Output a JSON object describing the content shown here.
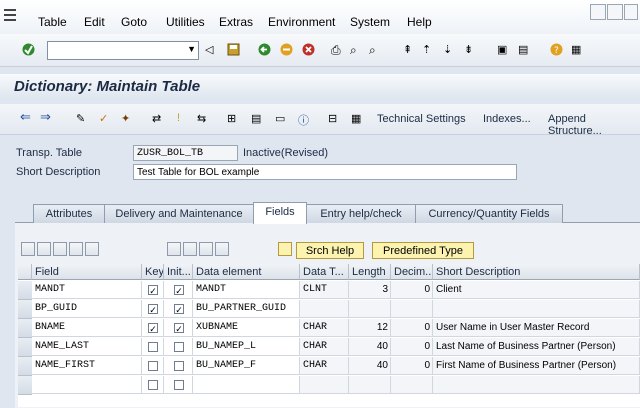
{
  "menu": [
    "Table",
    "Edit",
    "Goto",
    "Utilities",
    "Extras",
    "Environment",
    "System",
    "Help"
  ],
  "title": "Dictionary: Maintain Table",
  "app_toolbar": {
    "technical_settings": "Technical Settings",
    "indexes": "Indexes...",
    "append_structure": "Append Structure..."
  },
  "header": {
    "transp_table_label": "Transp. Table",
    "table_name": "ZUSR_BOL_TB",
    "status": "Inactive(Revised)",
    "short_desc_label": "Short Description",
    "short_desc": "Test Table for BOL example"
  },
  "tabs": [
    "Attributes",
    "Delivery and Maintenance",
    "Fields",
    "Entry help/check",
    "Currency/Quantity Fields"
  ],
  "active_tab": "Fields",
  "buttons": {
    "srch_help": "Srch Help",
    "predefined_type": "Predefined Type"
  },
  "columns": [
    "Field",
    "Key",
    "Init...",
    "Data element",
    "Data T...",
    "Length",
    "Decim...",
    "Short Description"
  ],
  "rows": [
    {
      "field": "MANDT",
      "key": true,
      "init": true,
      "element": "MANDT",
      "type": "CLNT",
      "length": "3",
      "dec": "0",
      "desc": "Client"
    },
    {
      "field": "BP_GUID",
      "key": true,
      "init": true,
      "element": "BU_PARTNER_GUID",
      "type": "",
      "length": "",
      "dec": "",
      "desc": ""
    },
    {
      "field": "BNAME",
      "key": true,
      "init": true,
      "element": "XUBNAME",
      "type": "CHAR",
      "length": "12",
      "dec": "0",
      "desc": "User Name in User Master Record"
    },
    {
      "field": "NAME_LAST",
      "key": false,
      "init": false,
      "element": "BU_NAMEP_L",
      "type": "CHAR",
      "length": "40",
      "dec": "0",
      "desc": "Last Name of Business Partner (Person)"
    },
    {
      "field": "NAME_FIRST",
      "key": false,
      "init": false,
      "element": "BU_NAMEP_F",
      "type": "CHAR",
      "length": "40",
      "dec": "0",
      "desc": "First Name of Business Partner (Person)"
    },
    {
      "field": "",
      "key": false,
      "init": false,
      "element": "",
      "type": "",
      "length": "",
      "dec": "",
      "desc": ""
    },
    {
      "field": "",
      "key": false,
      "init": false,
      "element": "",
      "type": "",
      "length": "",
      "dec": "",
      "desc": ""
    }
  ],
  "colors": {
    "accent_yellow": "#fdf3b0",
    "title_text": "#1b2b44"
  }
}
